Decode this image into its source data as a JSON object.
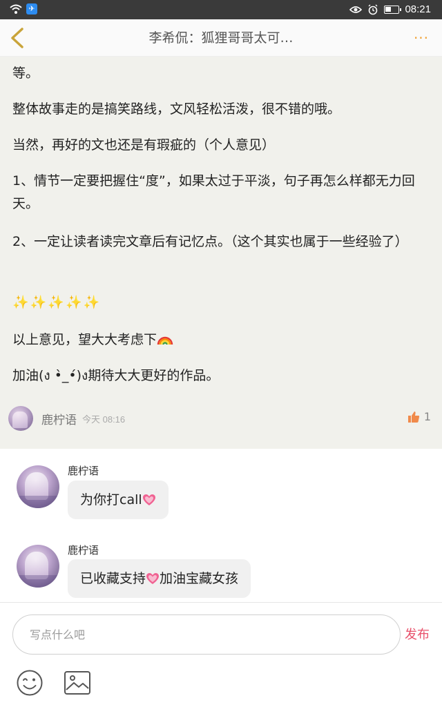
{
  "status_bar": {
    "time": "08:21",
    "app_badge": "✈"
  },
  "nav": {
    "title": "李希侃：狐狸哥哥太可…",
    "more": "···"
  },
  "post": {
    "lines": [
      "等。",
      "整体故事走的是搞笑路线，文风轻松活泼，很不错的哦。",
      "当然，再好的文也还是有瑕疵的（个人意见）",
      "1、情节一定要把握住“度”，如果太过于平淡，句子再怎么样都无力回天。",
      "2、一定让读者读完文章后有记忆点。（这个其实也属于一些经验了）",
      "✨✨✨✨✨",
      "以上意见，望大大考虑下",
      "加油(ง •̀_•́)ง期待大大更好的作品。"
    ],
    "author": "鹿柠语",
    "time": "今天 08:16",
    "likes": "1"
  },
  "replies": [
    {
      "name": "鹿柠语",
      "text_before": "为你打call",
      "text_after": ""
    },
    {
      "name": "鹿柠语",
      "text_before": "已收藏支持",
      "text_after": "加油宝藏女孩"
    }
  ],
  "composer": {
    "placeholder": "写点什么吧",
    "publish": "发布"
  },
  "colors": {
    "accent": "#f0a030",
    "publish": "#e8506a",
    "like": "#f08a4b",
    "post_bg": "#f1f1ec"
  }
}
